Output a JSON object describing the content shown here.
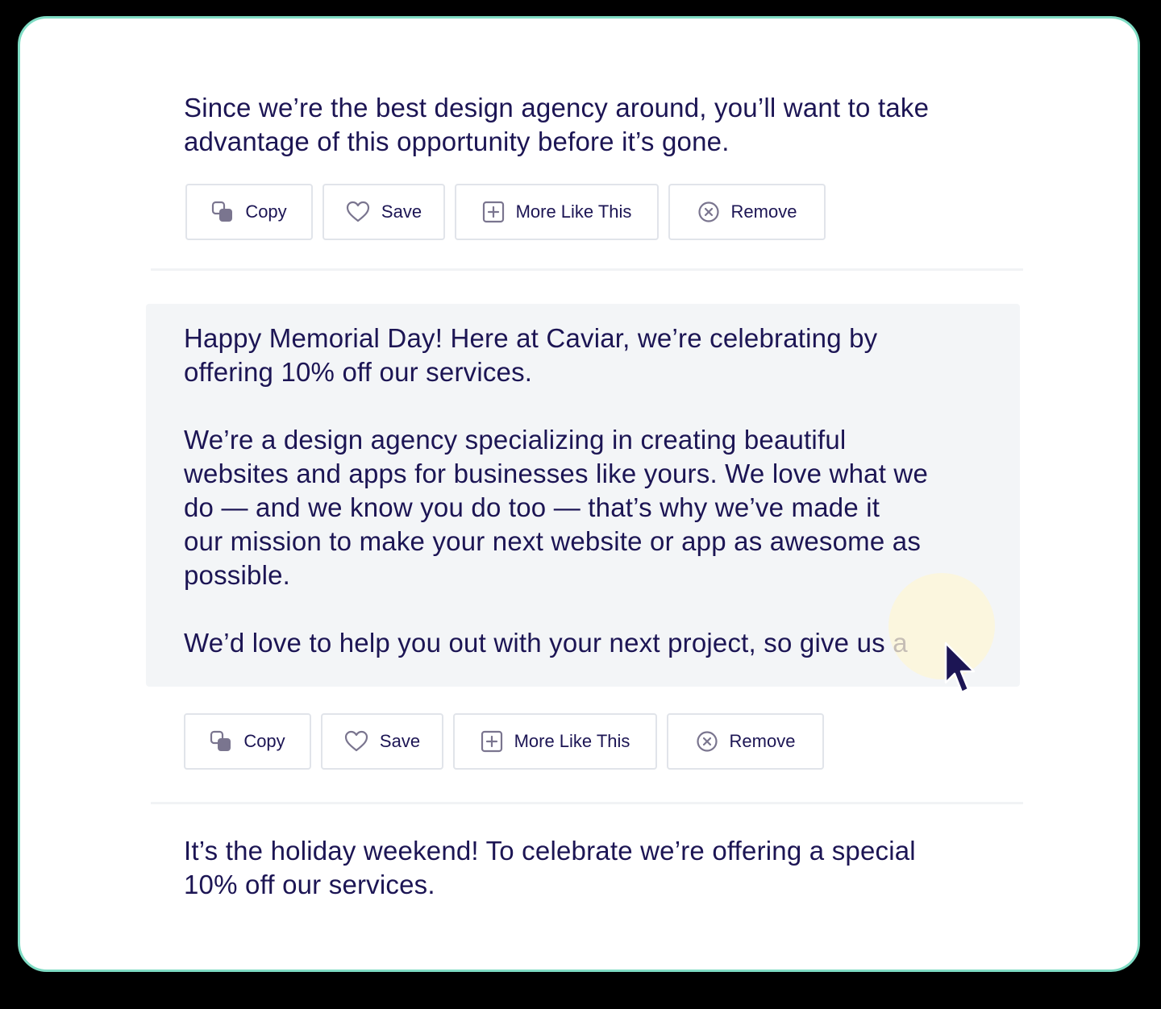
{
  "results": [
    {
      "lines": [
        "Since we’re the best design agency around, you’ll want to take",
        "advantage of this opportunity before it’s gone."
      ],
      "actions": {
        "copy": "Copy",
        "save": "Save",
        "more": "More Like This",
        "remove": "Remove"
      }
    },
    {
      "paragraphs": [
        [
          "Happy Memorial Day! Here at Caviar, we’re celebrating by",
          "offering 10% off our services."
        ],
        [
          "We’re a design agency specializing in creating beautiful",
          "websites and apps for businesses like yours. We love what we",
          "do — and we know you do too — that’s why we’ve made it",
          "our mission to make your next website or app as awesome as",
          "possible."
        ],
        [
          "We’d love to help you out with your next project, so give us a"
        ]
      ],
      "actions": {
        "copy": "Copy",
        "save": "Save",
        "more": "More Like This",
        "remove": "Remove"
      }
    },
    {
      "lines": [
        "It’s the holiday weekend! To celebrate we’re offering a special",
        "10% off our services."
      ]
    }
  ],
  "icons": {
    "copy": "copy-icon",
    "save": "heart-icon",
    "more": "plus-square-icon",
    "remove": "close-circle-icon",
    "pointer": "mouse-pointer-icon"
  },
  "colors": {
    "text": "#1c1554",
    "icon": "#7a758f",
    "border": "#e1e4ea",
    "highlight": "#f3f5f7",
    "frame": "#7fdcc4"
  }
}
